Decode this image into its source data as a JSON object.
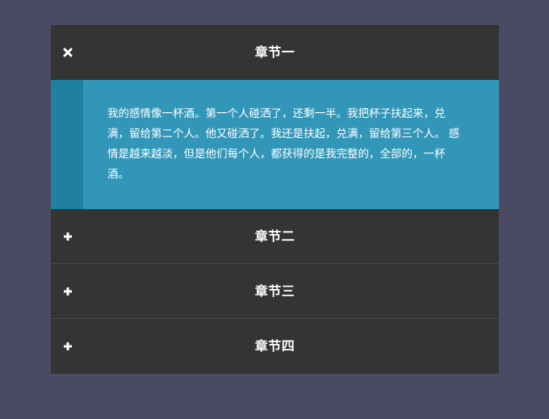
{
  "accordion": {
    "sections": [
      {
        "title": "章节一",
        "icon": "close-icon",
        "expanded": true,
        "content": "我的感情像一杯酒。第一个人碰洒了，还剩一半。我把杯子扶起来，兑满，留给第二个人。他又碰洒了。我还是扶起，兑满，留给第三个人。 感情是越来越淡，但是他们每个人，都获得的是我完整的，全部的，一杯酒。"
      },
      {
        "title": "章节二",
        "icon": "plus-icon",
        "expanded": false
      },
      {
        "title": "章节三",
        "icon": "plus-icon",
        "expanded": false
      },
      {
        "title": "章节四",
        "icon": "plus-icon",
        "expanded": false
      }
    ]
  },
  "colors": {
    "page_background": "#4a4b62",
    "header_background": "#343434",
    "expanded_body": "#3296b8",
    "expanded_body_strip": "#2080a0",
    "text": "#ffffff"
  }
}
